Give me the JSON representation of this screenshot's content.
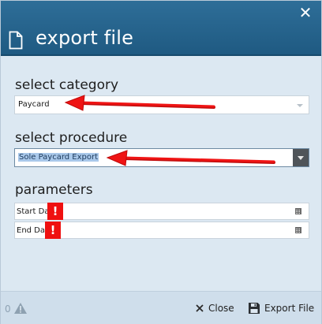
{
  "dialog": {
    "title": "export file",
    "close_glyph": "✕"
  },
  "category": {
    "label": "select category",
    "value": "Paycard"
  },
  "procedure": {
    "label": "select procedure",
    "value": "Sole Paycard Export"
  },
  "parameters": {
    "label": "parameters",
    "rows": [
      {
        "label": "Start Da",
        "error_glyph": "!"
      },
      {
        "label": "End Da",
        "error_glyph": "!"
      }
    ]
  },
  "footer": {
    "warning_count": "0",
    "close_label": "Close",
    "export_label": "Export File"
  },
  "colors": {
    "header": "#1f5a82",
    "body": "#dce8f2",
    "error": "#ef1010",
    "arrow": "#e50e0e",
    "selection": "#a9c8ea"
  },
  "icons": [
    "close-icon",
    "file-icon",
    "chevron-down-icon",
    "calendar-icon",
    "warning-icon",
    "save-icon",
    "red-arrow-annotation"
  ]
}
